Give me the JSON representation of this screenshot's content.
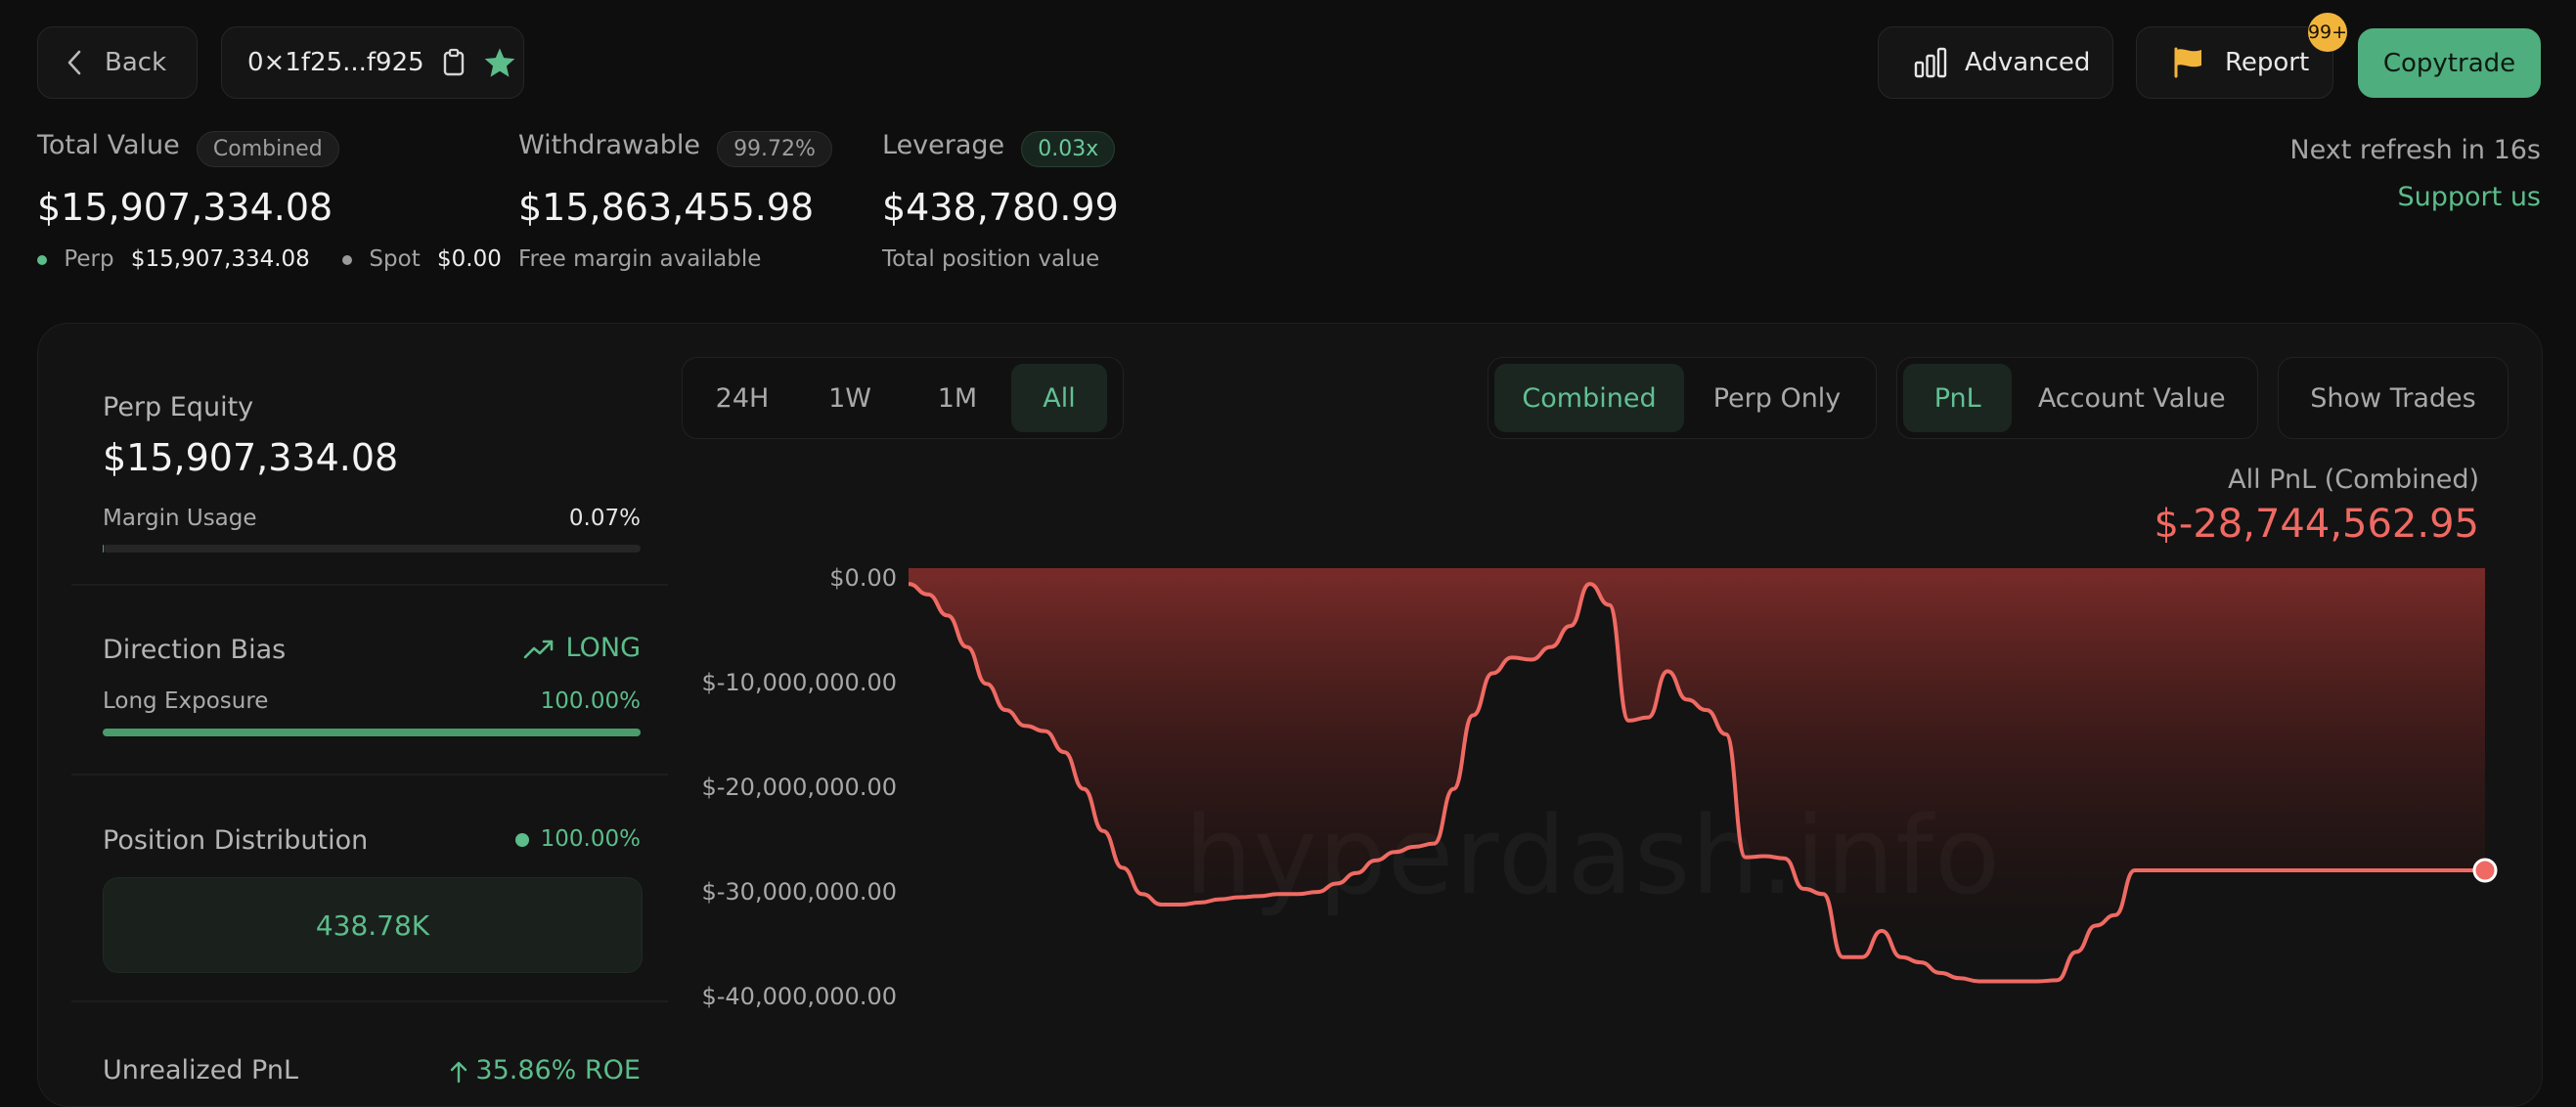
{
  "header": {
    "back_label": "Back",
    "address": "0×1f25...f925",
    "advanced_label": "Advanced",
    "report_label": "Report",
    "report_badge": "99+",
    "copytrade_label": "Copytrade"
  },
  "summary": {
    "total_value": {
      "label": "Total Value",
      "pill": "Combined",
      "value": "$15,907,334.08",
      "perp_label": "Perp",
      "perp_value": "$15,907,334.08",
      "spot_label": "Spot",
      "spot_value": "$0.00"
    },
    "withdrawable": {
      "label": "Withdrawable",
      "pill": "99.72%",
      "value": "$15,863,455.98",
      "sub": "Free margin available"
    },
    "leverage": {
      "label": "Leverage",
      "pill": "0.03x",
      "value": "$438,780.99",
      "sub": "Total position value"
    },
    "refresh_text": "Next refresh in 16s",
    "support_link": "Support us"
  },
  "side": {
    "perp_equity_label": "Perp Equity",
    "perp_equity_value": "$15,907,334.08",
    "margin_usage_label": "Margin Usage",
    "margin_usage_value": "0.07%",
    "margin_usage_fraction": 0.0007,
    "direction_bias_label": "Direction Bias",
    "direction_bias_value": "LONG",
    "long_exposure_label": "Long Exposure",
    "long_exposure_value": "100.00%",
    "long_exposure_fraction": 1.0,
    "position_distribution_label": "Position Distribution",
    "position_distribution_value": "100.00%",
    "position_box_value": "438.78K",
    "unrealized_pnl_label": "Unrealized PnL",
    "unrealized_pnl_value": "35.86% ROE"
  },
  "tabs": {
    "range": [
      "24H",
      "1W",
      "1M",
      "All"
    ],
    "range_active": "All",
    "scope": [
      "Combined",
      "Perp Only"
    ],
    "scope_active": "Combined",
    "metric": [
      "PnL",
      "Account Value"
    ],
    "metric_active": "PnL",
    "show_trades_label": "Show Trades"
  },
  "chart_header": {
    "title": "All PnL (Combined)",
    "value": "$-28,744,562.95"
  },
  "watermark": "hyperdash.info",
  "colors": {
    "accent": "#5cbd8a",
    "negative": "#ef6a63",
    "report_flag": "#f2b53c"
  },
  "chart_data": {
    "type": "area",
    "title": "All PnL (Combined)",
    "ylim": [
      -40000000,
      0
    ],
    "y_ticks": [
      "$0.00",
      "$-10,000,000.00",
      "$-20,000,000.00",
      "$-30,000,000.00",
      "$-40,000,000.00"
    ],
    "y_tick_values": [
      0,
      -10000000,
      -20000000,
      -30000000,
      -40000000
    ],
    "x": [
      0,
      1,
      2,
      3,
      4,
      5,
      6,
      7,
      8,
      9,
      10,
      11,
      12,
      13,
      14,
      15,
      16,
      17,
      18,
      19,
      20,
      21,
      22,
      23,
      24,
      25,
      26,
      27,
      28,
      29,
      30,
      31,
      32,
      33,
      34,
      35,
      36,
      37,
      38,
      39,
      40,
      41,
      42,
      43,
      44,
      45,
      46,
      47,
      48,
      49,
      50,
      51,
      52,
      53,
      54,
      55,
      56,
      57,
      58,
      59,
      60,
      61,
      62,
      63,
      64,
      65,
      66,
      67,
      68,
      69,
      70,
      71,
      72,
      73,
      74,
      75,
      76,
      77,
      78,
      79,
      80,
      81
    ],
    "values": [
      -1500000,
      -2500000,
      -4500000,
      -7500000,
      -11000000,
      -13500000,
      -15000000,
      -15500000,
      -17500000,
      -21000000,
      -25000000,
      -28500000,
      -31000000,
      -32000000,
      -32000000,
      -31800000,
      -31500000,
      -31300000,
      -31200000,
      -31000000,
      -31000000,
      -30800000,
      -30000000,
      -29000000,
      -27800000,
      -27000000,
      -26500000,
      -26200000,
      -21000000,
      -14000000,
      -10000000,
      -8500000,
      -8700000,
      -7500000,
      -5500000,
      -1500000,
      -3500000,
      -14500000,
      -14200000,
      -9800000,
      -12500000,
      -13500000,
      -15800000,
      -27500000,
      -27400000,
      -27600000,
      -30500000,
      -31000000,
      -37000000,
      -37000000,
      -34500000,
      -37000000,
      -37500000,
      -38500000,
      -39000000,
      -39300000,
      -39300000,
      -39300000,
      -39300000,
      -39200000,
      -36500000,
      -34000000,
      -33000000,
      -28744562.95,
      -28744562.95,
      -28744562.95,
      -28744562.95,
      -28744562.95,
      -28744562.95,
      -28744562.95,
      -28744562.95,
      -28744562.95,
      -28744562.95,
      -28744562.95,
      -28744562.95,
      -28744562.95,
      -28744562.95,
      -28744562.95,
      -28744562.95,
      -28744562.95,
      -28744562.95,
      -28744562.95
    ],
    "series": [
      {
        "name": "",
        "color": "#ef6a63"
      }
    ],
    "grid": false
  }
}
